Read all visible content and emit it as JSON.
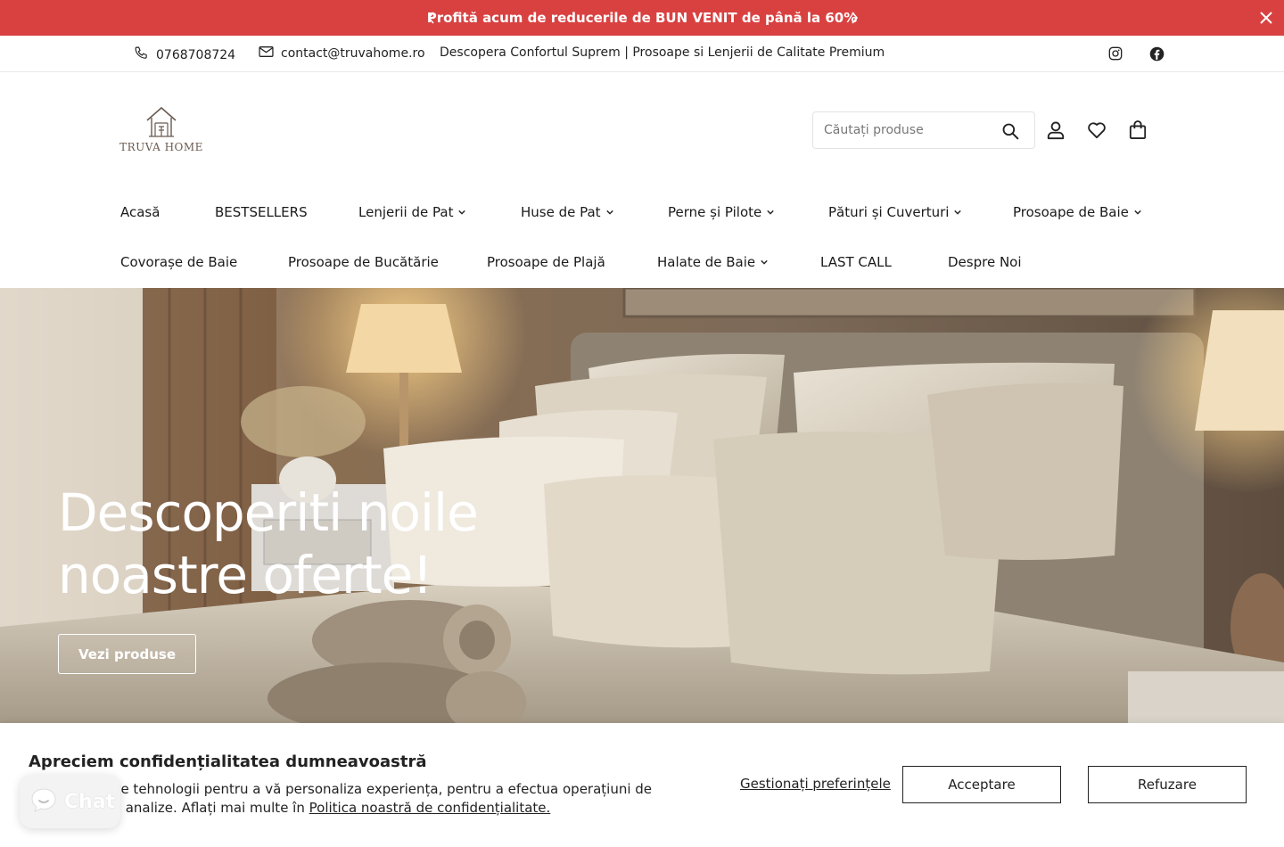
{
  "announcement": {
    "message": "Profită acum de reducerile de BUN VENIT de până la 60%",
    "bg_color": "#d94141"
  },
  "topbar": {
    "phone": "0768708724",
    "email": "contact@truvahome.ro",
    "tagline": "Descopera Confortul Suprem | Prosoape si Lenjerii de Calitate Premium"
  },
  "header": {
    "brand": "TRUVA HOME",
    "search_placeholder": "Căutați produse"
  },
  "nav": {
    "row1": [
      {
        "label": "Acasă",
        "dropdown": false
      },
      {
        "label": "BESTSELLERS",
        "dropdown": false
      },
      {
        "label": "Lenjerii de Pat",
        "dropdown": true
      },
      {
        "label": "Huse de Pat",
        "dropdown": true
      },
      {
        "label": "Perne și Pilote",
        "dropdown": true
      },
      {
        "label": "Pături și Cuverturi",
        "dropdown": true
      },
      {
        "label": "Prosoape de Baie",
        "dropdown": true
      }
    ],
    "row2": [
      {
        "label": "Covorașe de Baie",
        "dropdown": false
      },
      {
        "label": "Prosoape de Bucătărie",
        "dropdown": false
      },
      {
        "label": "Prosoape de Plajă",
        "dropdown": false
      },
      {
        "label": "Halate de Baie",
        "dropdown": true
      },
      {
        "label": "LAST CALL",
        "dropdown": false
      },
      {
        "label": "Despre Noi",
        "dropdown": false
      }
    ]
  },
  "hero": {
    "title_line1": "Descoperiti noile",
    "title_line2": "noastre oferte!",
    "button": "Vezi produse"
  },
  "cookie": {
    "title": "Apreciem confidențialitatea dumneavoastră",
    "text": "e cookie și alte tehnologii pentru a vă personaliza experiența, pentru a efectua operațiuni de",
    "text2": "ntru a colecta analize. Aflați mai multe în ",
    "link": "Politica noastră de confidențialitate.",
    "manage": "Gestionați preferințele",
    "accept": "Acceptare",
    "refuse": "Refuzare"
  },
  "chat": {
    "label": "Chat"
  }
}
